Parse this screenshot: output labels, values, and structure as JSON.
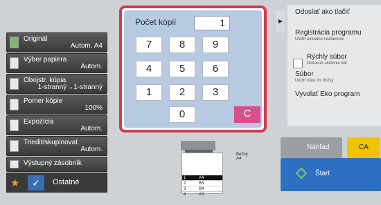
{
  "sidebar": {
    "items": [
      {
        "label": "Originál",
        "value": "Autom.  A4"
      },
      {
        "label": "Výber papiera",
        "value": "Autom."
      },
      {
        "label": "Obojstr. kópia",
        "value": "1-stranný→1-stranný"
      },
      {
        "label": "Pomer kópie",
        "value": "100%"
      },
      {
        "label": "Expozícia",
        "value": "Autom."
      },
      {
        "label": "Triedit/skupinovat",
        "value": "Autom."
      },
      {
        "label": "Výstupný zásobník",
        "value": ""
      }
    ],
    "others": "Ostatné"
  },
  "copies": {
    "title": "Počet kópií",
    "value": "1",
    "keys": [
      "7",
      "8",
      "9",
      "4",
      "5",
      "6",
      "1",
      "2",
      "3",
      "0"
    ],
    "clear": "C"
  },
  "menu": {
    "send": "Odoslať ako tlačiť",
    "register": "Registrácia programu",
    "register_sub": "Uložiť aktuálne nastavenie",
    "quick": "Rýchly súbor",
    "quick_sub": "Dočasné uloženie dát",
    "file": "Súbor",
    "file_sub": "Uložiť dáta do zložky",
    "eco": "Vyvolať Eko program"
  },
  "trays": [
    {
      "n": "1",
      "s": "A4"
    },
    {
      "n": "2",
      "s": "B5"
    },
    {
      "n": "3",
      "s": "B4"
    },
    {
      "n": "4",
      "s": "A3"
    }
  ],
  "bezny": "Bežný",
  "bezny_size": "A4",
  "preview": "Náhľad",
  "ca": "CA",
  "start": "Štart"
}
